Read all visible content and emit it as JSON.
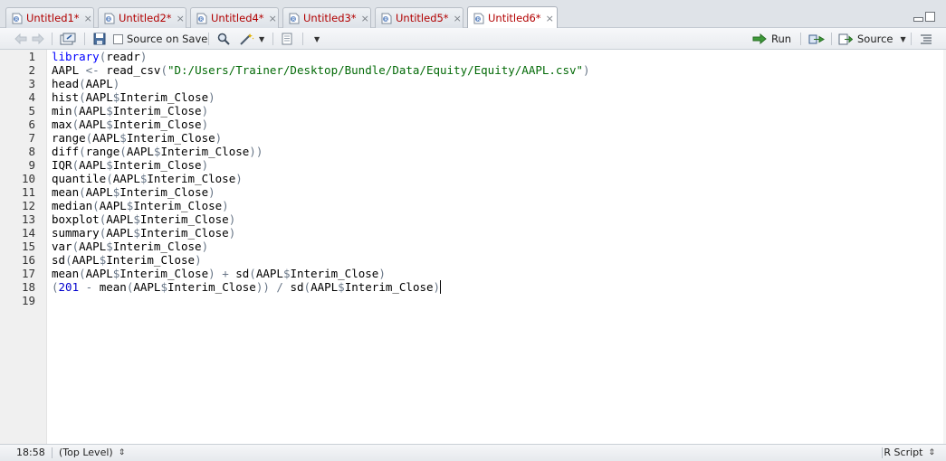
{
  "tabs": [
    {
      "label": "Untitled1*",
      "close": "×"
    },
    {
      "label": "Untitled2*",
      "close": "×"
    },
    {
      "label": "Untitled4*",
      "close": "×"
    },
    {
      "label": "Untitled3*",
      "close": "×"
    },
    {
      "label": "Untitled5*",
      "close": "×"
    },
    {
      "label": "Untitled6*",
      "close": "×"
    }
  ],
  "active_tab": 5,
  "toolbar": {
    "source_on_save_label": "Source on Save",
    "run_label": "Run",
    "source_label": "Source"
  },
  "editor": {
    "line_numbers": [
      "1",
      "2",
      "3",
      "4",
      "5",
      "6",
      "7",
      "8",
      "9",
      "10",
      "11",
      "12",
      "13",
      "14",
      "15",
      "16",
      "17",
      "18",
      "19"
    ],
    "lines": [
      "library(readr)",
      "AAPL <- read_csv(\"D:/Users/Trainer/Desktop/Bundle/Data/Equity/Equity/AAPL.csv\")",
      "head(AAPL)",
      "hist(AAPL$Interim_Close)",
      "min(AAPL$Interim_Close)",
      "max(AAPL$Interim_Close)",
      "range(AAPL$Interim_Close)",
      "diff(range(AAPL$Interim_Close))",
      "IQR(AAPL$Interim_Close)",
      "quantile(AAPL$Interim_Close)",
      "mean(AAPL$Interim_Close)",
      "median(AAPL$Interim_Close)",
      "boxplot(AAPL$Interim_Close)",
      "summary(AAPL$Interim_Close)",
      "var(AAPL$Interim_Close)",
      "sd(AAPL$Interim_Close)",
      "mean(AAPL$Interim_Close) + sd(AAPL$Interim_Close)",
      "(201 - mean(AAPL$Interim_Close)) / sd(AAPL$Interim_Close)",
      ""
    ]
  },
  "statusbar": {
    "cursor_position": "18:58",
    "scope": "(Top Level)",
    "file_type": "R Script"
  },
  "colors": {
    "keyword": "#0000ff",
    "string": "#036a07",
    "operator": "#687687",
    "number": "#0000cd",
    "tab_label": "#b20000"
  }
}
